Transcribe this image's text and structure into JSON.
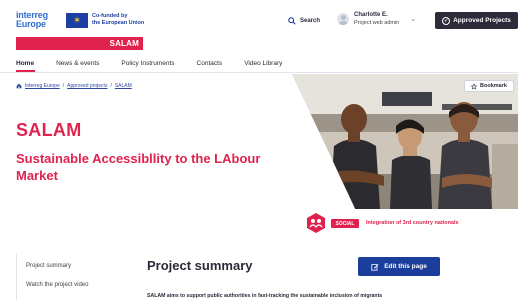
{
  "header": {
    "logo_line1": "interreg",
    "logo_line2": "Europe",
    "eu_funding_line1": "Co-funded by",
    "eu_funding_line2": "the European Union",
    "project_band_label": "SALAM",
    "search_label": "Search",
    "user_name": "Charlotte E.",
    "user_role": "Project web admin",
    "approved_projects_label": "Approved Projects"
  },
  "nav": {
    "items": [
      "Home",
      "News & events",
      "Policy Instruments",
      "Contacts",
      "Video Library"
    ],
    "active": "Home"
  },
  "breadcrumb": [
    "Interreg Europe",
    "Approved projects",
    "SALAM"
  ],
  "project": {
    "acronym": "SALAM",
    "full_title": "Sustainable Accessibllity to the LAbour Market",
    "bookmark_label": "Bookmark",
    "topic_badge": "SOCIAL",
    "topic_label": "Integration of 3rd country nationals"
  },
  "sidebar": {
    "items": [
      "Project summary",
      "Watch the project video"
    ]
  },
  "summary": {
    "heading": "Project summary",
    "edit_label": "Edit this page",
    "intro": "SALAM aims to support public authorities in fast-tracking the sustainable inclusion of migrants"
  },
  "colors": {
    "accent": "#e0224f",
    "primary_button": "#1b3d9c",
    "dark_button": "#2b2b3a"
  }
}
